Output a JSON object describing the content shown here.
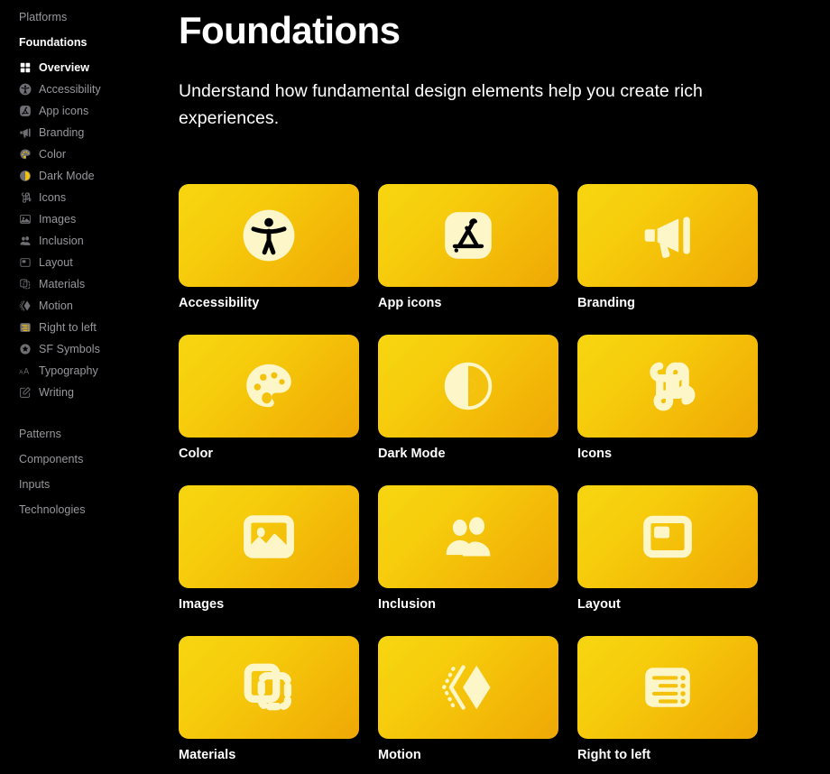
{
  "sidebar": {
    "top_group": {
      "label": "Platforms"
    },
    "active_group": {
      "label": "Foundations"
    },
    "items": [
      {
        "label": "Overview",
        "icon": "grid-icon",
        "current": true
      },
      {
        "label": "Accessibility",
        "icon": "accessibility-icon",
        "current": false
      },
      {
        "label": "App icons",
        "icon": "app-store-icon",
        "current": false
      },
      {
        "label": "Branding",
        "icon": "megaphone-icon",
        "current": false
      },
      {
        "label": "Color",
        "icon": "palette-icon",
        "current": false
      },
      {
        "label": "Dark Mode",
        "icon": "contrast-icon",
        "current": false
      },
      {
        "label": "Icons",
        "icon": "command-icon",
        "current": false
      },
      {
        "label": "Images",
        "icon": "photo-icon",
        "current": false
      },
      {
        "label": "Inclusion",
        "icon": "people-icon",
        "current": false
      },
      {
        "label": "Layout",
        "icon": "layout-icon",
        "current": false
      },
      {
        "label": "Materials",
        "icon": "layers-icon",
        "current": false
      },
      {
        "label": "Motion",
        "icon": "motion-icon",
        "current": false
      },
      {
        "label": "Right to left",
        "icon": "rtl-icon",
        "current": false
      },
      {
        "label": "SF Symbols",
        "icon": "sf-symbols-icon",
        "current": false
      },
      {
        "label": "Typography",
        "icon": "typography-icon",
        "current": false
      },
      {
        "label": "Writing",
        "icon": "pencil-square-icon",
        "current": false
      }
    ],
    "tail_groups": [
      {
        "label": "Patterns"
      },
      {
        "label": "Components"
      },
      {
        "label": "Inputs"
      },
      {
        "label": "Technologies"
      }
    ]
  },
  "main": {
    "title": "Foundations",
    "description": "Understand how fundamental design elements help you create rich experiences.",
    "cards": [
      {
        "label": "Accessibility",
        "icon": "accessibility-icon"
      },
      {
        "label": "App icons",
        "icon": "app-store-icon"
      },
      {
        "label": "Branding",
        "icon": "megaphone-icon"
      },
      {
        "label": "Color",
        "icon": "palette-icon"
      },
      {
        "label": "Dark Mode",
        "icon": "contrast-icon"
      },
      {
        "label": "Icons",
        "icon": "command-icon"
      },
      {
        "label": "Images",
        "icon": "photo-icon"
      },
      {
        "label": "Inclusion",
        "icon": "people-icon"
      },
      {
        "label": "Layout",
        "icon": "layout-icon"
      },
      {
        "label": "Materials",
        "icon": "layers-icon"
      },
      {
        "label": "Motion",
        "icon": "motion-icon"
      },
      {
        "label": "Right to left",
        "icon": "rtl-icon"
      }
    ]
  },
  "colors": {
    "background": "#000000",
    "tile_gradient_start": "#F7D511",
    "tile_gradient_end": "#EFA806",
    "tile_icon": "#FCF6C8",
    "text_primary": "#FFFFFF",
    "text_muted": "#98989D"
  }
}
